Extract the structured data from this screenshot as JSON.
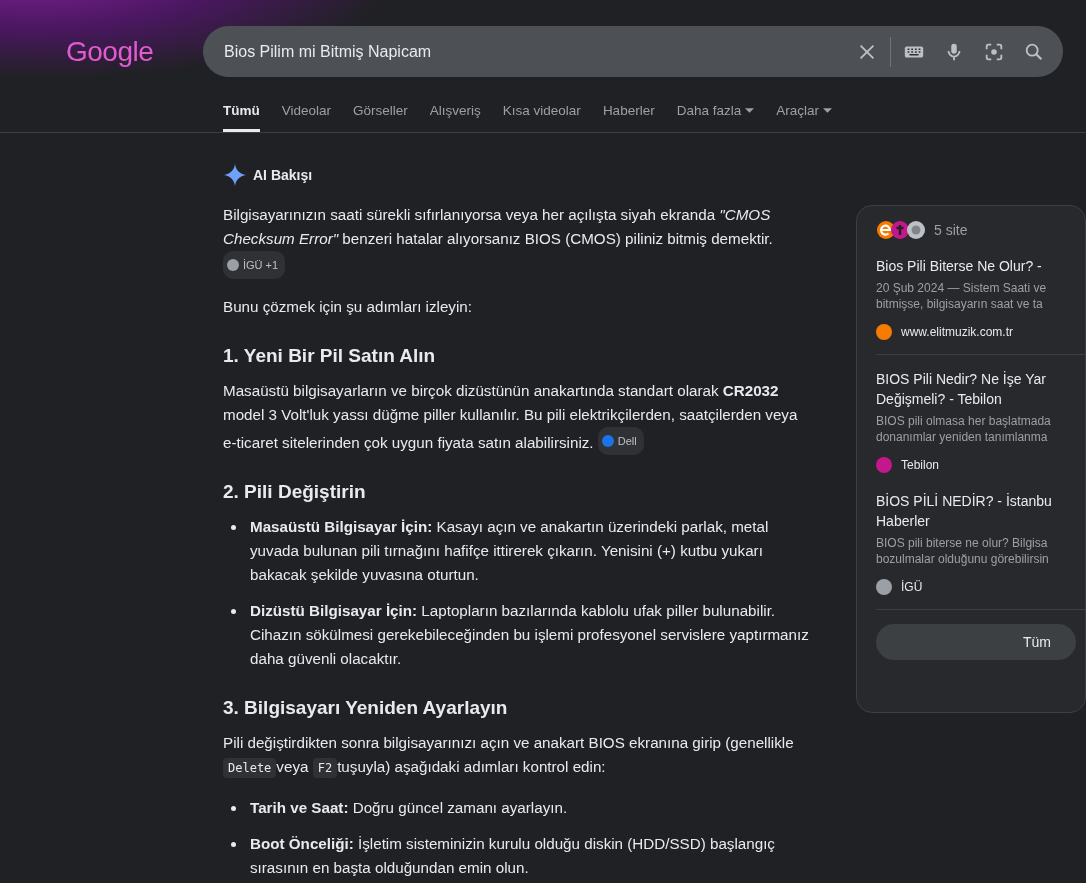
{
  "logo": "Google",
  "search": {
    "value": "Bios Pilim mi Bitmiş Napicam"
  },
  "tabs": [
    {
      "label": "Tümü",
      "selected": true,
      "dropdown": false
    },
    {
      "label": "Videolar",
      "selected": false,
      "dropdown": false
    },
    {
      "label": "Görseller",
      "selected": false,
      "dropdown": false
    },
    {
      "label": "Alışveriş",
      "selected": false,
      "dropdown": false
    },
    {
      "label": "Kısa videolar",
      "selected": false,
      "dropdown": false
    },
    {
      "label": "Haberler",
      "selected": false,
      "dropdown": false
    },
    {
      "label": "Daha fazla",
      "selected": false,
      "dropdown": true
    },
    {
      "label": "Araçlar",
      "selected": false,
      "dropdown": true
    }
  ],
  "ai_overview": {
    "title": "AI Bakışı",
    "blocks": [
      {
        "kind": "paragraph",
        "parts": [
          {
            "kind": "text",
            "text": "Bilgisayarınızın saati sürekli sıfırlanıyorsa veya her açılışta siyah ekranda *\"CMOS Checksum Error\"* benzeri hatalar alıyorsanız BIOS (CMOS) piliniz bitmiş demektir."
          },
          {
            "kind": "chip",
            "text": "İGÜ +1",
            "color": "#9aa0a6"
          }
        ]
      },
      {
        "kind": "paragraph",
        "parts": [
          {
            "kind": "text",
            "text": "Bunu çözmek için şu adımları izleyin:"
          }
        ]
      },
      {
        "kind": "heading",
        "text": "1. Yeni Bir Pil Satın Alın"
      },
      {
        "kind": "paragraph",
        "parts": [
          {
            "kind": "text",
            "text": "Masaüstü bilgisayarların ve birçok dizüstünün anakartında standart olarak **CR2032** model 3 Volt'luk yassı düğme piller kullanılır. Bu pili elektrikçilerden, saatçilerden veya e-ticaret sitelerinden çok uygun fiyata satın alabilirsiniz."
          },
          {
            "kind": "chip",
            "text": "Dell",
            "color": "#1a73e8"
          }
        ]
      },
      {
        "kind": "heading",
        "text": "2. Pili Değiştirin"
      },
      {
        "kind": "list",
        "items": [
          "**Masaüstü Bilgisayar İçin:** Kasayı açın ve anakartın üzerindeki parlak, metal yuvada bulunan pili tırnağını hafifçe ittirerek çıkarın. Yenisini (+) kutbu yukarı bakacak şekilde yuvasına oturtun.",
          "**Dizüstü Bilgisayar İçin:** Laptopların bazılarında kablolu ufak piller bulunabilir. Cihazın sökülmesi gerekebileceğinden bu işlemi profesyonel servislere yaptırmanız daha güvenli olacaktır."
        ]
      },
      {
        "kind": "heading",
        "text": "3. Bilgisayarı Yeniden Ayarlayın"
      },
      {
        "kind": "paragraph",
        "parts": [
          {
            "kind": "text",
            "text": "Pili değiştirdikten sonra bilgisayarınızı açın ve anakart BIOS ekranına girip (genellikle"
          },
          {
            "kind": "code",
            "text": "Delete"
          },
          {
            "kind": "text",
            "text": "veya"
          },
          {
            "kind": "code",
            "text": "F2"
          },
          {
            "kind": "text",
            "text": "tuşuyla) aşağıdaki adımları kontrol edin:"
          }
        ]
      },
      {
        "kind": "list",
        "items": [
          "**Tarih ve Saat:** Doğru güncel zamanı ayarlayın.",
          "**Boot Önceliği:** İşletim sisteminizin kurulu olduğu diskin (HDD/SSD) başlangıç sırasının en başta olduğundan emin olun."
        ]
      }
    ]
  },
  "sources_panel": {
    "count": "5 site",
    "sources": [
      {
        "title_lines": [
          "Bios Pili Biterse Ne Olur? -"
        ],
        "snippet_lines": [
          "20 Şub 2024 — Sistem Saati ve",
          "bitmişse, bilgisayarın saat ve ta"
        ],
        "site": "www.elitmuzik.com.tr",
        "color": "#f57c00"
      },
      {
        "title_lines": [
          "BIOS Pili Nedir? Ne İşe Yar",
          "Değişmeli? - Tebilon"
        ],
        "snippet_lines": [
          "BIOS pili olmasa her başlatmada",
          "donanımlar yeniden tanımlanma"
        ],
        "site": "Tebilon",
        "color": "#c2188b"
      },
      {
        "title_lines": [
          "BİOS PİLİ NEDİR? - İstanbu",
          "Haberler"
        ],
        "snippet_lines": [
          "BIOS pili biterse ne olur? Bilgisa",
          "bozulmalar olduğunu görebilirsin"
        ],
        "site": "İGÜ",
        "color": "#9aa0a6"
      }
    ],
    "button": "Tüm"
  }
}
